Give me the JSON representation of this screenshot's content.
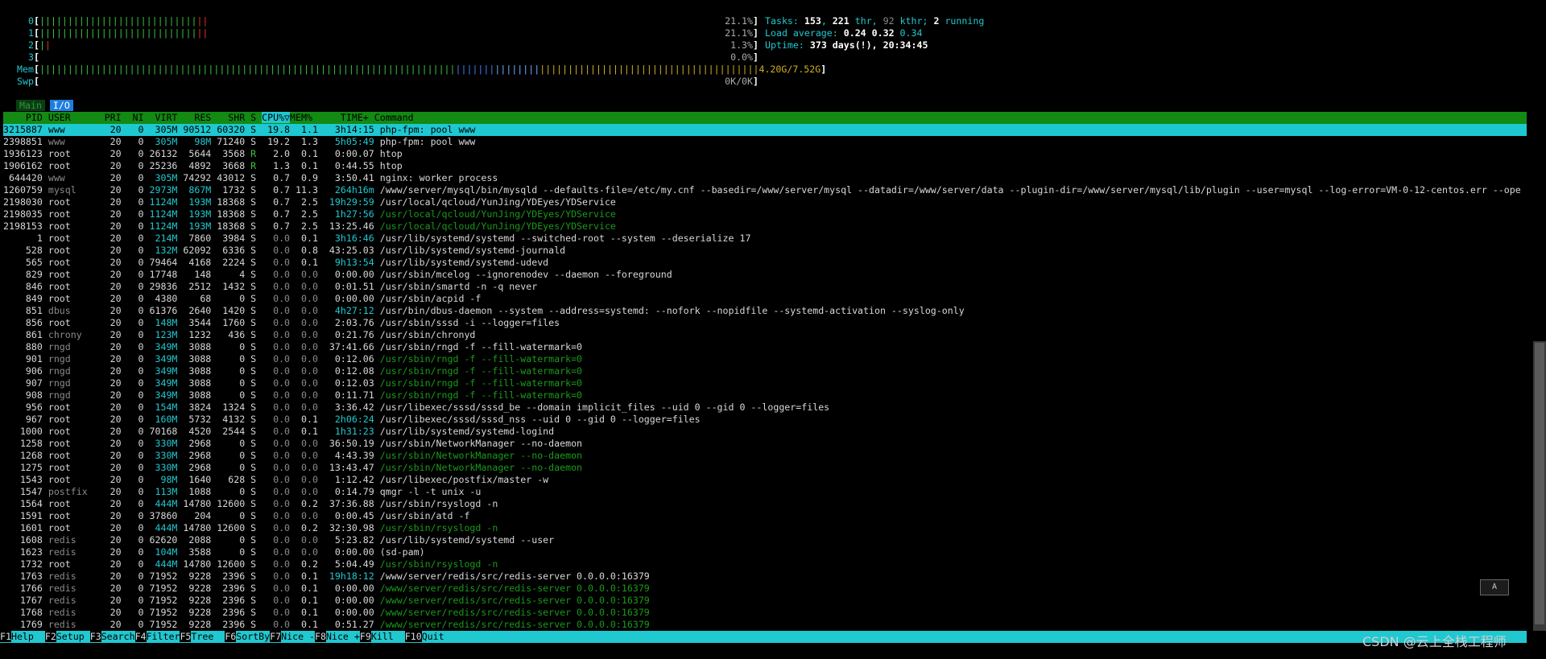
{
  "meters": {
    "cpu": [
      {
        "label": "0",
        "value": "21.1%"
      },
      {
        "label": "1",
        "value": "21.1%"
      },
      {
        "label": "2",
        "value": "1.3%"
      },
      {
        "label": "3",
        "value": "0.0%"
      }
    ],
    "mem": {
      "label": "Mem",
      "value": "4.20G/7.52G"
    },
    "swp": {
      "label": "Swp",
      "value": "0K/0K"
    }
  },
  "summary": {
    "tasks_label": "Tasks:",
    "tasks": "153",
    "thr": "221",
    "thr_label": "thr,",
    "kthr": "92",
    "kthr_label": "kthr;",
    "running": "2",
    "running_label": "running",
    "load_label": "Load average:",
    "load1": "0.24",
    "load5": "0.32",
    "load15": "0.34",
    "uptime_label": "Uptime:",
    "uptime_days": "373 days(!),",
    "uptime_time": "20:34:45"
  },
  "tabs": {
    "main": "Main",
    "io": "I/O"
  },
  "columns": {
    "pid": "PID",
    "user": "USER",
    "pri": "PRI",
    "ni": "NI",
    "virt": "VIRT",
    "res": "RES",
    "shr": "SHR",
    "s": "S",
    "cpu": "CPU%▽",
    "mem": "MEM%",
    "time": "TIME+",
    "cmd": "Command"
  },
  "processes": [
    {
      "pid": "3215887",
      "user": "www",
      "pri": "20",
      "ni": "0",
      "virt": "305M",
      "res": "90512",
      "shr": "60320",
      "s": "S",
      "cpu": "19.8",
      "mem": "1.1",
      "time": "3h14:15",
      "cmd": "php-fpm: pool www",
      "sel": true
    },
    {
      "pid": "2398851",
      "user": "www",
      "pri": "20",
      "ni": "0",
      "virt": "305M",
      "res": "98M",
      "shr": "71240",
      "s": "S",
      "cpu": "19.2",
      "mem": "1.3",
      "time": "5h05:49",
      "cmd": "php-fpm: pool www",
      "ug": true
    },
    {
      "pid": "1936123",
      "user": "root",
      "pri": "20",
      "ni": "0",
      "virt": "26132",
      "res": "5644",
      "shr": "3568",
      "s": "R",
      "cpu": "2.0",
      "mem": "0.1",
      "time": "0:00.07",
      "cmd": "htop"
    },
    {
      "pid": "1906162",
      "user": "root",
      "pri": "20",
      "ni": "0",
      "virt": "25236",
      "res": "4892",
      "shr": "3668",
      "s": "R",
      "cpu": "1.3",
      "mem": "0.1",
      "time": "0:44.55",
      "cmd": "htop"
    },
    {
      "pid": "644420",
      "user": "www",
      "pri": "20",
      "ni": "0",
      "virt": "305M",
      "res": "74292",
      "shr": "43012",
      "s": "S",
      "cpu": "0.7",
      "mem": "0.9",
      "time": "3:50.41",
      "cmd": "nginx: worker process",
      "ug": true
    },
    {
      "pid": "1260759",
      "user": "mysql",
      "pri": "20",
      "ni": "0",
      "virt": "2973M",
      "res": "867M",
      "shr": "1732",
      "s": "S",
      "cpu": "0.7",
      "mem": "11.3",
      "time": "264h16m",
      "cmd": "/www/server/mysql/bin/mysqld --defaults-file=/etc/my.cnf --basedir=/www/server/mysql --datadir=/www/server/data --plugin-dir=/www/server/mysql/lib/plugin --user=mysql --log-error=VM-0-12-centos.err --ope",
      "ug": true
    },
    {
      "pid": "2198030",
      "user": "root",
      "pri": "20",
      "ni": "0",
      "virt": "1124M",
      "res": "193M",
      "shr": "18368",
      "s": "S",
      "cpu": "0.7",
      "mem": "2.5",
      "time": "19h29:59",
      "cmd": "/usr/local/qcloud/YunJing/YDEyes/YDService"
    },
    {
      "pid": "2198035",
      "user": "root",
      "pri": "20",
      "ni": "0",
      "virt": "1124M",
      "res": "193M",
      "shr": "18368",
      "s": "S",
      "cpu": "0.7",
      "mem": "2.5",
      "time": "1h27:56",
      "cmd": "/usr/local/qcloud/YunJing/YDEyes/YDService",
      "thr": true
    },
    {
      "pid": "2198153",
      "user": "root",
      "pri": "20",
      "ni": "0",
      "virt": "1124M",
      "res": "193M",
      "shr": "18368",
      "s": "S",
      "cpu": "0.7",
      "mem": "2.5",
      "time": "13:25.46",
      "cmd": "/usr/local/qcloud/YunJing/YDEyes/YDService",
      "thr": true
    },
    {
      "pid": "1",
      "user": "root",
      "pri": "20",
      "ni": "0",
      "virt": "214M",
      "res": "7860",
      "shr": "3984",
      "s": "S",
      "cpu": "0.0",
      "mem": "0.1",
      "time": "3h16:46",
      "cmd": "/usr/lib/systemd/systemd --switched-root --system --deserialize 17"
    },
    {
      "pid": "528",
      "user": "root",
      "pri": "20",
      "ni": "0",
      "virt": "132M",
      "res": "62092",
      "shr": "6336",
      "s": "S",
      "cpu": "0.0",
      "mem": "0.8",
      "time": "43:25.03",
      "cmd": "/usr/lib/systemd/systemd-journald"
    },
    {
      "pid": "565",
      "user": "root",
      "pri": "20",
      "ni": "0",
      "virt": "79464",
      "res": "4168",
      "shr": "2224",
      "s": "S",
      "cpu": "0.0",
      "mem": "0.1",
      "time": "9h13:54",
      "cmd": "/usr/lib/systemd/systemd-udevd"
    },
    {
      "pid": "829",
      "user": "root",
      "pri": "20",
      "ni": "0",
      "virt": "17748",
      "res": "148",
      "shr": "4",
      "s": "S",
      "cpu": "0.0",
      "mem": "0.0",
      "time": "0:00.00",
      "cmd": "/usr/sbin/mcelog --ignorenodev --daemon --foreground"
    },
    {
      "pid": "846",
      "user": "root",
      "pri": "20",
      "ni": "0",
      "virt": "29836",
      "res": "2512",
      "shr": "1432",
      "s": "S",
      "cpu": "0.0",
      "mem": "0.0",
      "time": "0:01.51",
      "cmd": "/usr/sbin/smartd -n -q never"
    },
    {
      "pid": "849",
      "user": "root",
      "pri": "20",
      "ni": "0",
      "virt": "4380",
      "res": "68",
      "shr": "0",
      "s": "S",
      "cpu": "0.0",
      "mem": "0.0",
      "time": "0:00.00",
      "cmd": "/usr/sbin/acpid -f"
    },
    {
      "pid": "851",
      "user": "dbus",
      "pri": "20",
      "ni": "0",
      "virt": "61376",
      "res": "2640",
      "shr": "1420",
      "s": "S",
      "cpu": "0.0",
      "mem": "0.0",
      "time": "4h27:12",
      "cmd": "/usr/bin/dbus-daemon --system --address=systemd: --nofork --nopidfile --systemd-activation --syslog-only",
      "ug": true
    },
    {
      "pid": "856",
      "user": "root",
      "pri": "20",
      "ni": "0",
      "virt": "148M",
      "res": "3544",
      "shr": "1760",
      "s": "S",
      "cpu": "0.0",
      "mem": "0.0",
      "time": "2:03.76",
      "cmd": "/usr/sbin/sssd -i --logger=files"
    },
    {
      "pid": "861",
      "user": "chrony",
      "pri": "20",
      "ni": "0",
      "virt": "123M",
      "res": "1232",
      "shr": "436",
      "s": "S",
      "cpu": "0.0",
      "mem": "0.0",
      "time": "0:21.76",
      "cmd": "/usr/sbin/chronyd",
      "ug": true
    },
    {
      "pid": "880",
      "user": "rngd",
      "pri": "20",
      "ni": "0",
      "virt": "349M",
      "res": "3088",
      "shr": "0",
      "s": "S",
      "cpu": "0.0",
      "mem": "0.0",
      "time": "37:41.66",
      "cmd": "/usr/sbin/rngd -f --fill-watermark=0",
      "ug": true
    },
    {
      "pid": "901",
      "user": "rngd",
      "pri": "20",
      "ni": "0",
      "virt": "349M",
      "res": "3088",
      "shr": "0",
      "s": "S",
      "cpu": "0.0",
      "mem": "0.0",
      "time": "0:12.06",
      "cmd": "/usr/sbin/rngd -f --fill-watermark=0",
      "ug": true,
      "thr": true
    },
    {
      "pid": "906",
      "user": "rngd",
      "pri": "20",
      "ni": "0",
      "virt": "349M",
      "res": "3088",
      "shr": "0",
      "s": "S",
      "cpu": "0.0",
      "mem": "0.0",
      "time": "0:12.08",
      "cmd": "/usr/sbin/rngd -f --fill-watermark=0",
      "ug": true,
      "thr": true
    },
    {
      "pid": "907",
      "user": "rngd",
      "pri": "20",
      "ni": "0",
      "virt": "349M",
      "res": "3088",
      "shr": "0",
      "s": "S",
      "cpu": "0.0",
      "mem": "0.0",
      "time": "0:12.03",
      "cmd": "/usr/sbin/rngd -f --fill-watermark=0",
      "ug": true,
      "thr": true
    },
    {
      "pid": "908",
      "user": "rngd",
      "pri": "20",
      "ni": "0",
      "virt": "349M",
      "res": "3088",
      "shr": "0",
      "s": "S",
      "cpu": "0.0",
      "mem": "0.0",
      "time": "0:11.71",
      "cmd": "/usr/sbin/rngd -f --fill-watermark=0",
      "ug": true,
      "thr": true
    },
    {
      "pid": "956",
      "user": "root",
      "pri": "20",
      "ni": "0",
      "virt": "154M",
      "res": "3824",
      "shr": "1324",
      "s": "S",
      "cpu": "0.0",
      "mem": "0.0",
      "time": "3:36.42",
      "cmd": "/usr/libexec/sssd/sssd_be --domain implicit_files --uid 0 --gid 0 --logger=files"
    },
    {
      "pid": "967",
      "user": "root",
      "pri": "20",
      "ni": "0",
      "virt": "160M",
      "res": "5732",
      "shr": "4132",
      "s": "S",
      "cpu": "0.0",
      "mem": "0.1",
      "time": "2h06:24",
      "cmd": "/usr/libexec/sssd/sssd_nss --uid 0 --gid 0 --logger=files"
    },
    {
      "pid": "1000",
      "user": "root",
      "pri": "20",
      "ni": "0",
      "virt": "70168",
      "res": "4520",
      "shr": "2544",
      "s": "S",
      "cpu": "0.0",
      "mem": "0.1",
      "time": "1h31:23",
      "cmd": "/usr/lib/systemd/systemd-logind"
    },
    {
      "pid": "1258",
      "user": "root",
      "pri": "20",
      "ni": "0",
      "virt": "330M",
      "res": "2968",
      "shr": "0",
      "s": "S",
      "cpu": "0.0",
      "mem": "0.0",
      "time": "36:50.19",
      "cmd": "/usr/sbin/NetworkManager --no-daemon"
    },
    {
      "pid": "1268",
      "user": "root",
      "pri": "20",
      "ni": "0",
      "virt": "330M",
      "res": "2968",
      "shr": "0",
      "s": "S",
      "cpu": "0.0",
      "mem": "0.0",
      "time": "4:43.39",
      "cmd": "/usr/sbin/NetworkManager --no-daemon",
      "thr": true
    },
    {
      "pid": "1275",
      "user": "root",
      "pri": "20",
      "ni": "0",
      "virt": "330M",
      "res": "2968",
      "shr": "0",
      "s": "S",
      "cpu": "0.0",
      "mem": "0.0",
      "time": "13:43.47",
      "cmd": "/usr/sbin/NetworkManager --no-daemon",
      "thr": true
    },
    {
      "pid": "1543",
      "user": "root",
      "pri": "20",
      "ni": "0",
      "virt": "98M",
      "res": "1640",
      "shr": "628",
      "s": "S",
      "cpu": "0.0",
      "mem": "0.0",
      "time": "1:12.42",
      "cmd": "/usr/libexec/postfix/master -w"
    },
    {
      "pid": "1547",
      "user": "postfix",
      "pri": "20",
      "ni": "0",
      "virt": "113M",
      "res": "1088",
      "shr": "0",
      "s": "S",
      "cpu": "0.0",
      "mem": "0.0",
      "time": "0:14.79",
      "cmd": "qmgr -l -t unix -u",
      "ug": true
    },
    {
      "pid": "1564",
      "user": "root",
      "pri": "20",
      "ni": "0",
      "virt": "444M",
      "res": "14780",
      "shr": "12600",
      "s": "S",
      "cpu": "0.0",
      "mem": "0.2",
      "time": "37:36.88",
      "cmd": "/usr/sbin/rsyslogd -n"
    },
    {
      "pid": "1591",
      "user": "root",
      "pri": "20",
      "ni": "0",
      "virt": "37860",
      "res": "204",
      "shr": "0",
      "s": "S",
      "cpu": "0.0",
      "mem": "0.0",
      "time": "0:00.45",
      "cmd": "/usr/sbin/atd -f"
    },
    {
      "pid": "1601",
      "user": "root",
      "pri": "20",
      "ni": "0",
      "virt": "444M",
      "res": "14780",
      "shr": "12600",
      "s": "S",
      "cpu": "0.0",
      "mem": "0.2",
      "time": "32:30.98",
      "cmd": "/usr/sbin/rsyslogd -n",
      "thr": true
    },
    {
      "pid": "1608",
      "user": "redis",
      "pri": "20",
      "ni": "0",
      "virt": "62620",
      "res": "2088",
      "shr": "0",
      "s": "S",
      "cpu": "0.0",
      "mem": "0.0",
      "time": "5:23.82",
      "cmd": "/usr/lib/systemd/systemd --user",
      "ug": true
    },
    {
      "pid": "1623",
      "user": "redis",
      "pri": "20",
      "ni": "0",
      "virt": "104M",
      "res": "3588",
      "shr": "0",
      "s": "S",
      "cpu": "0.0",
      "mem": "0.0",
      "time": "0:00.00",
      "cmd": "(sd-pam)",
      "ug": true
    },
    {
      "pid": "1732",
      "user": "root",
      "pri": "20",
      "ni": "0",
      "virt": "444M",
      "res": "14780",
      "shr": "12600",
      "s": "S",
      "cpu": "0.0",
      "mem": "0.2",
      "time": "5:04.49",
      "cmd": "/usr/sbin/rsyslogd -n",
      "thr": true
    },
    {
      "pid": "1763",
      "user": "redis",
      "pri": "20",
      "ni": "0",
      "virt": "71952",
      "res": "9228",
      "shr": "2396",
      "s": "S",
      "cpu": "0.0",
      "mem": "0.1",
      "time": "19h18:12",
      "cmd": "/www/server/redis/src/redis-server 0.0.0.0:16379",
      "ug": true
    },
    {
      "pid": "1766",
      "user": "redis",
      "pri": "20",
      "ni": "0",
      "virt": "71952",
      "res": "9228",
      "shr": "2396",
      "s": "S",
      "cpu": "0.0",
      "mem": "0.1",
      "time": "0:00.00",
      "cmd": "/www/server/redis/src/redis-server 0.0.0.0:16379",
      "ug": true,
      "thr": true
    },
    {
      "pid": "1767",
      "user": "redis",
      "pri": "20",
      "ni": "0",
      "virt": "71952",
      "res": "9228",
      "shr": "2396",
      "s": "S",
      "cpu": "0.0",
      "mem": "0.1",
      "time": "0:00.00",
      "cmd": "/www/server/redis/src/redis-server 0.0.0.0:16379",
      "ug": true,
      "thr": true
    },
    {
      "pid": "1768",
      "user": "redis",
      "pri": "20",
      "ni": "0",
      "virt": "71952",
      "res": "9228",
      "shr": "2396",
      "s": "S",
      "cpu": "0.0",
      "mem": "0.1",
      "time": "0:00.00",
      "cmd": "/www/server/redis/src/redis-server 0.0.0.0:16379",
      "ug": true,
      "thr": true
    },
    {
      "pid": "1769",
      "user": "redis",
      "pri": "20",
      "ni": "0",
      "virt": "71952",
      "res": "9228",
      "shr": "2396",
      "s": "S",
      "cpu": "0.0",
      "mem": "0.1",
      "time": "0:51.27",
      "cmd": "/www/server/redis/src/redis-server 0.0.0.0:16379",
      "ug": true,
      "thr": true
    }
  ],
  "footer": [
    {
      "key": "F1",
      "label": "Help  "
    },
    {
      "key": "F2",
      "label": "Setup "
    },
    {
      "key": "F3",
      "label": "Search"
    },
    {
      "key": "F4",
      "label": "Filter"
    },
    {
      "key": "F5",
      "label": "Tree  "
    },
    {
      "key": "F6",
      "label": "SortBy"
    },
    {
      "key": "F7",
      "label": "Nice -"
    },
    {
      "key": "F8",
      "label": "Nice +"
    },
    {
      "key": "F9",
      "label": "Kill  "
    },
    {
      "key": "F10",
      "label": "Quit"
    }
  ],
  "ime_label": "A",
  "watermark": "CSDN @云上全栈工程师"
}
